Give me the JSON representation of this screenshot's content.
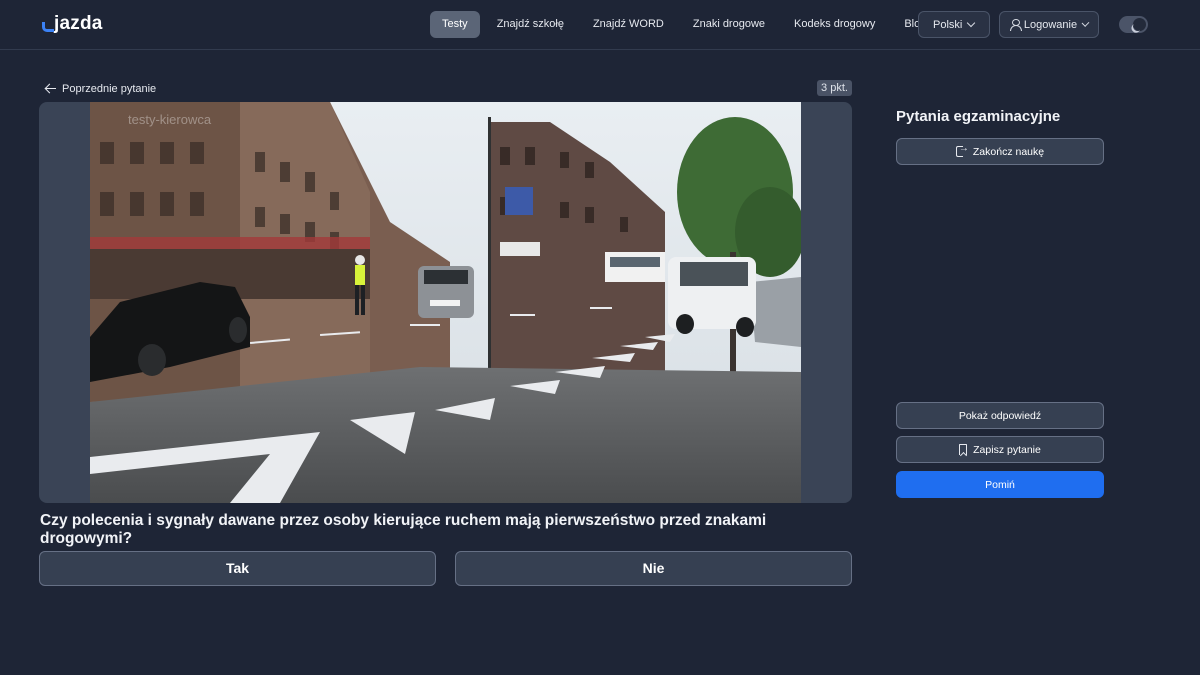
{
  "header": {
    "logo_text": "jazda",
    "nav": [
      {
        "label": "Testy",
        "active": true
      },
      {
        "label": "Znajdź szkołę",
        "active": false
      },
      {
        "label": "Znajdź WORD",
        "active": false
      },
      {
        "label": "Znaki drogowe",
        "active": false
      },
      {
        "label": "Kodeks drogowy",
        "active": false
      },
      {
        "label": "Blog",
        "active": false
      }
    ],
    "language_label": "Polski",
    "login_label": "Logowanie"
  },
  "main": {
    "back_label": "Poprzednie pytanie",
    "points": "3 pkt.",
    "question": "Czy polecenia i sygnały dawane przez osoby kierujące ruchem mają pierwszeństwo przed znakami drogowymi?",
    "answers": {
      "yes": "Tak",
      "no": "Nie"
    },
    "image_watermark": "testy-kierowca"
  },
  "sidebar": {
    "title": "Pytania egzaminacyjne",
    "finish_label": "Zakończ naukę",
    "show_answer_label": "Pokaż odpowiedź",
    "save_label": "Zapisz pytanie",
    "skip_label": "Pomiń"
  },
  "colors": {
    "background": "#1e2536",
    "accent": "#1f6ef0",
    "logo_mark": "#3b82f6"
  }
}
